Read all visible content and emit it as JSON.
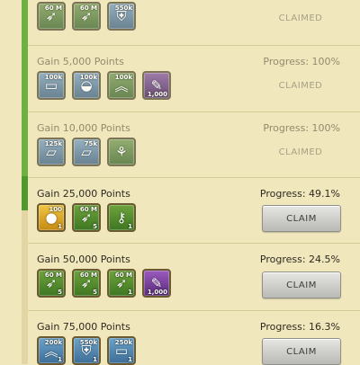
{
  "tiers": [
    {
      "gain": "",
      "progress": "",
      "status": "CLAIMED",
      "rewards": [
        {
          "icon": "speedup-arrow-icon",
          "top": "60 M",
          "bot": ""
        },
        {
          "icon": "speedup-arrow-icon",
          "top": "60 M",
          "bot": ""
        },
        {
          "icon": "shield-sword-icon",
          "top": "550k",
          "bot": ""
        }
      ]
    },
    {
      "gain": "Gain 5,000 Points",
      "progress": "Progress: 100%",
      "status": "CLAIMED",
      "rewards": [
        {
          "icon": "wood-logs-icon",
          "top": "100k",
          "bot": ""
        },
        {
          "icon": "ore-cart-icon",
          "top": "100k",
          "bot": ""
        },
        {
          "icon": "rank-chevron-icon",
          "top": "100k",
          "bot": ""
        },
        {
          "icon": "scroll-icon",
          "top": "",
          "bot": "1,000"
        }
      ]
    },
    {
      "gain": "Gain 10,000 Points",
      "progress": "Progress: 100%",
      "status": "CLAIMED",
      "rewards": [
        {
          "icon": "iron-bars-icon",
          "top": "125k",
          "bot": ""
        },
        {
          "icon": "iron-bars-icon",
          "top": "75k",
          "bot": ""
        },
        {
          "icon": "wheat-field-icon",
          "top": "",
          "bot": ""
        }
      ]
    },
    {
      "gain": "Gain 25,000 Points",
      "progress": "Progress: 49.1%",
      "button": "CLAIM",
      "rewards": [
        {
          "icon": "gold-coin-icon",
          "top": "100",
          "bot": "1"
        },
        {
          "icon": "speedup-arrow-icon",
          "top": "60 M",
          "bot": "5"
        },
        {
          "icon": "key-icon",
          "top": "",
          "bot": "1"
        }
      ]
    },
    {
      "gain": "Gain 50,000 Points",
      "progress": "Progress: 24.5%",
      "button": "CLAIM",
      "rewards": [
        {
          "icon": "speedup-arrow-icon",
          "top": "60 M",
          "bot": "5"
        },
        {
          "icon": "speedup-arrow-icon",
          "top": "60 M",
          "bot": "5"
        },
        {
          "icon": "speedup-arrow-icon",
          "top": "60 M",
          "bot": "1"
        },
        {
          "icon": "scroll-icon",
          "top": "",
          "bot": "1,000"
        }
      ]
    },
    {
      "gain": "Gain 75,000 Points",
      "progress": "Progress: 16.3%",
      "button": "CLAIM",
      "rewards": [
        {
          "icon": "rank-chevron-icon",
          "top": "200k",
          "bot": "1"
        },
        {
          "icon": "shield-sword-icon",
          "top": "550k",
          "bot": "1"
        },
        {
          "icon": "wood-logs-icon",
          "top": "250k",
          "bot": "1"
        }
      ]
    }
  ]
}
